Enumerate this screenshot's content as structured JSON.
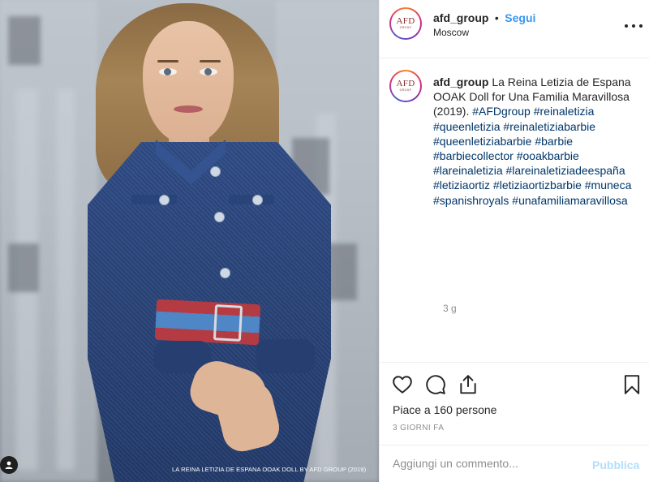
{
  "post": {
    "image_overlay_caption": "LA REINA LETIZIA DE ESPANA OOAK DOLL  BY AFD GROUP (2019)"
  },
  "header": {
    "avatar_logo": "AFD",
    "avatar_logo_sub": "GROUP",
    "username": "afd_group",
    "separator": "•",
    "follow_label": "Segui",
    "location": "Moscow"
  },
  "caption": {
    "username": "afd_group",
    "text": "La Reina Letizia de Espana OOAK Doll for Una Familia Maravillosa (2019).",
    "hashtags": [
      "#AFDgroup",
      "#reinaletizia",
      "#queenletizia",
      "#reinaletiziabarbie",
      "#queenletiziabarbie",
      "#barbie",
      "#barbiecollector",
      "#ooakbarbie",
      "#lareinaletizia",
      "#lareinaletiziadeespaña",
      "#letiziaortiz",
      "#letiziaortizbarbie",
      "#muneca",
      "#spanishroyals",
      "#unafamiliamaravillosa"
    ],
    "time": "3 g"
  },
  "actions": {
    "likes_text": "Piace a 160 persone",
    "days_ago": "3 GIORNI FA",
    "icons": [
      "heart-icon",
      "comment-icon",
      "share-icon",
      "bookmark-icon"
    ]
  },
  "comment": {
    "placeholder": "Aggiungi un commento...",
    "publish_label": "Pubblica"
  },
  "colors": {
    "link_blue": "#3897f0",
    "hashtag": "#003569",
    "muted": "#8e8e8e",
    "publish_disabled": "#b2dffc"
  }
}
